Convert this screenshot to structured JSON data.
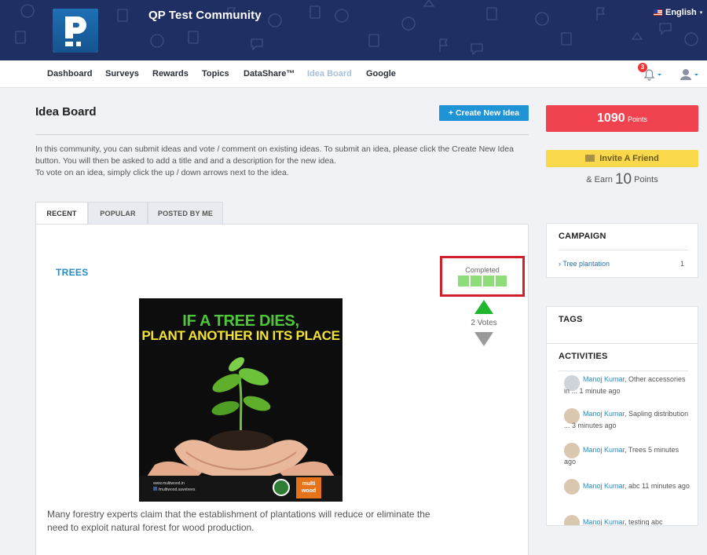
{
  "header": {
    "app_title": "QP Test Community",
    "language": "English",
    "logo_icon": "p-logo-icon"
  },
  "nav": {
    "items": [
      "Dashboard",
      "Surveys",
      "Rewards",
      "Topics",
      "DataShare™",
      "Idea Board",
      "Google"
    ],
    "active": "Idea Board",
    "notification_count": "3"
  },
  "main": {
    "page_title": "Idea Board",
    "create_button": "+ Create New Idea",
    "description": [
      "In this community, you can submit ideas and vote / comment on existing ideas. To submit an idea, please click the Create New Idea",
      "button. You will then be asked to add a title and and a description for the new idea.",
      "To vote on an idea, simply click the up / down arrows next to the idea."
    ],
    "tabs": [
      "RECENT",
      "POPULAR",
      "POSTED BY ME"
    ],
    "active_tab": "RECENT"
  },
  "idea": {
    "title": "TREES",
    "status_label": "Completed",
    "status_segments": 4,
    "votes": "2 Votes",
    "image_line1": "IF A TREE DIES,",
    "image_line2": "PLANT ANOTHER IN ITS PLACE",
    "image_url_1": "www.multiwood.in",
    "image_url_2": "/multiwood.savetrees",
    "image_brand": "multi wood",
    "body": "Many forestry experts claim that the establishment of plantations will reduce or eliminate the need to exploit natural forest for wood production."
  },
  "sidebar": {
    "points_value": "1090",
    "points_label": "Points",
    "invite_label": "Invite A Friend",
    "earn_prefix": "& Earn",
    "earn_value": "10",
    "earn_suffix": "Points",
    "campaign_title": "CAMPAIGN",
    "campaign_item": "› Tree plantation",
    "campaign_count": "1",
    "tags_title": "TAGS",
    "activities_title": "ACTIVITIES",
    "activities": [
      {
        "name": "Manoj Kumar",
        "text": ", Other accessories in ... ",
        "time": "1 minute ago"
      },
      {
        "name": "Manoj Kumar",
        "text": ", Sapling distribution ... ",
        "time": "3 minutes ago"
      },
      {
        "name": "Manoj Kumar",
        "text": ", Trees ",
        "time": "5 minutes ago"
      },
      {
        "name": "Manoj Kumar",
        "text": ", abc ",
        "time": "11 minutes ago"
      },
      {
        "name": "Manoj Kumar",
        "text": ", testing abc",
        "time": ""
      }
    ]
  },
  "colors": {
    "header_bg": "#1f2f63",
    "accent_blue": "#1e93d6",
    "points_red": "#f0434f",
    "invite_yellow": "#f9d84b",
    "status_green": "#8fdc7a",
    "highlight_red": "#d0202a"
  }
}
